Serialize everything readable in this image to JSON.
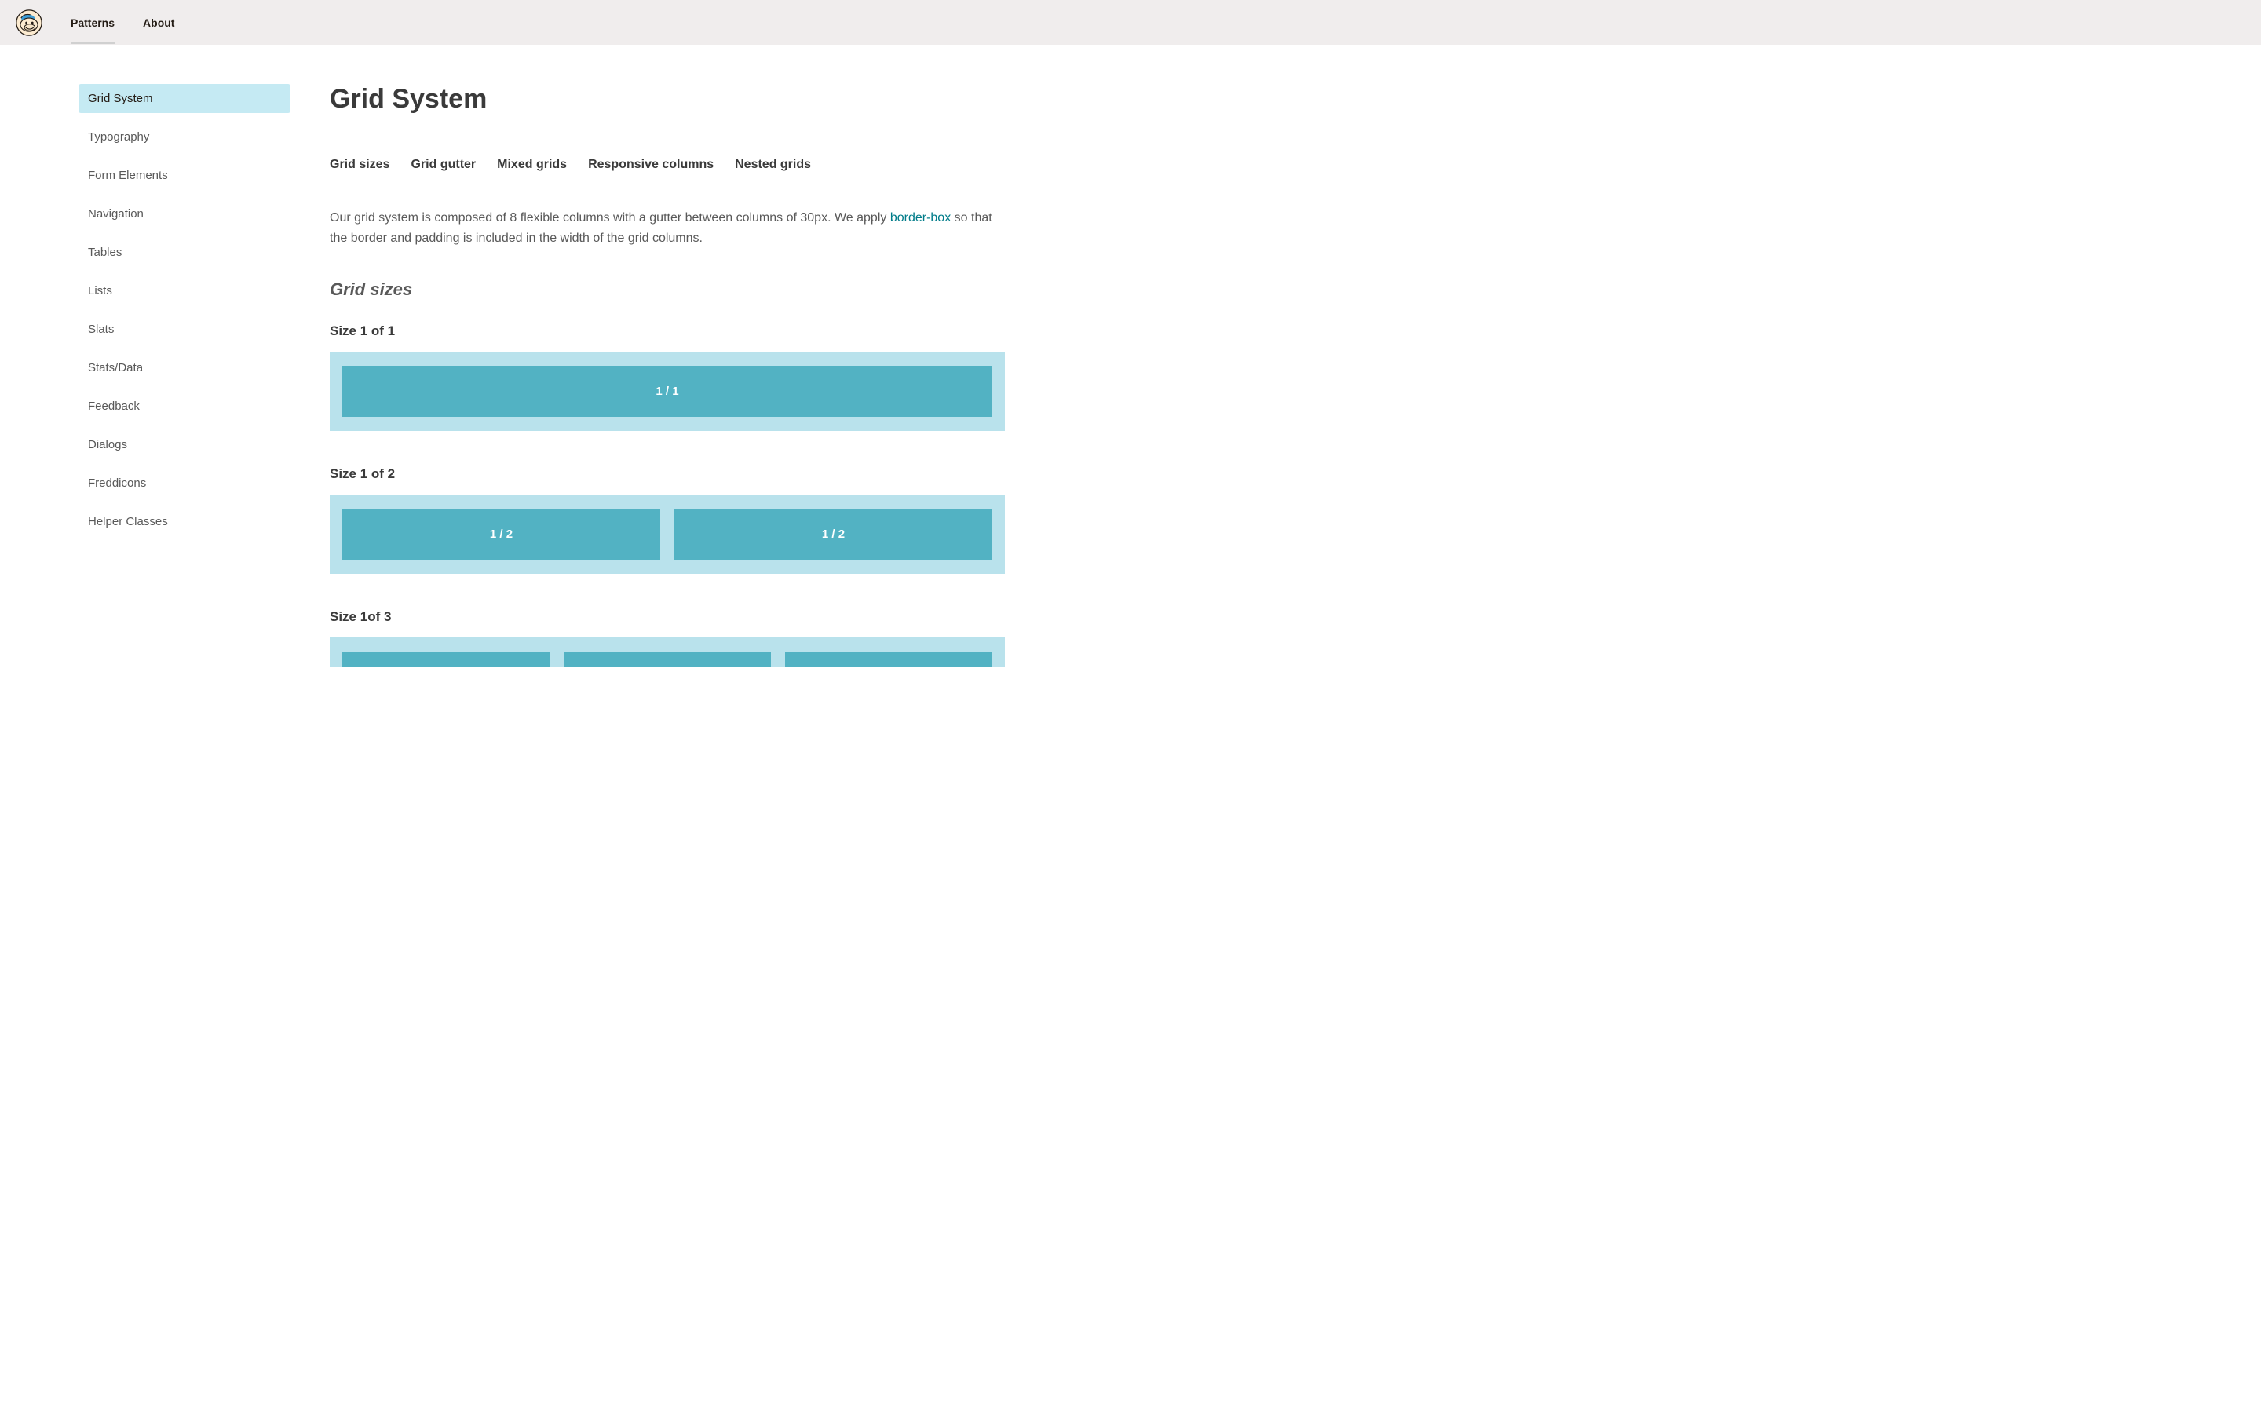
{
  "header": {
    "nav": [
      {
        "label": "Patterns",
        "active": true
      },
      {
        "label": "About",
        "active": false
      }
    ]
  },
  "sidebar": {
    "items": [
      {
        "label": "Grid System",
        "active": true
      },
      {
        "label": "Typography"
      },
      {
        "label": "Form Elements"
      },
      {
        "label": "Navigation"
      },
      {
        "label": "Tables"
      },
      {
        "label": "Lists"
      },
      {
        "label": "Slats"
      },
      {
        "label": "Stats/Data"
      },
      {
        "label": "Feedback"
      },
      {
        "label": "Dialogs"
      },
      {
        "label": "Freddicons"
      },
      {
        "label": "Helper Classes"
      }
    ]
  },
  "main": {
    "title": "Grid System",
    "tabs": [
      "Grid sizes",
      "Grid gutter",
      "Mixed grids",
      "Responsive columns",
      "Nested grids"
    ],
    "intro_before": "Our grid system is composed of 8 flexible columns with a gutter between columns of 30px. We apply ",
    "intro_link": "border-box",
    "intro_after": " so that the border and padding is included in the width of the grid columns.",
    "section_title": "Grid sizes",
    "demos": [
      {
        "label": "Size 1 of 1",
        "cells": [
          "1 / 1"
        ]
      },
      {
        "label": "Size 1 of 2",
        "cells": [
          "1 / 2",
          "1 / 2"
        ]
      },
      {
        "label": "Size 1of 3",
        "cells": [
          "",
          "",
          ""
        ]
      }
    ]
  }
}
